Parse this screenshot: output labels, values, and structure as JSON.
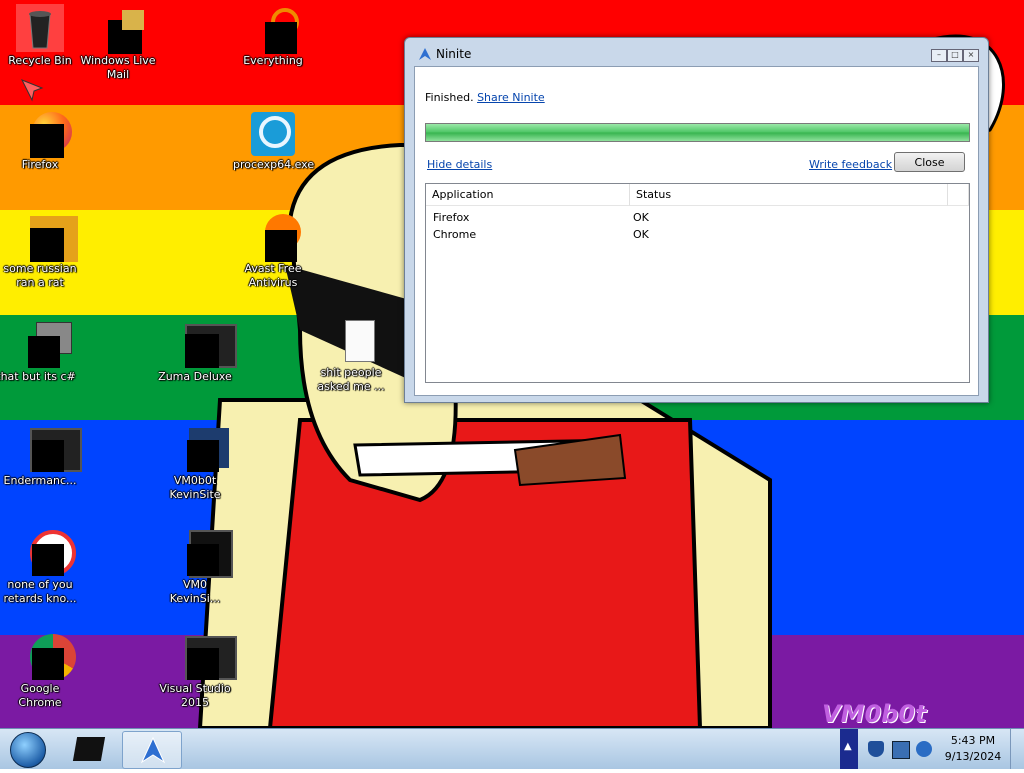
{
  "desktop": {
    "watermark": "VM0b0t",
    "colors": {
      "red": "#ff0000",
      "orange": "#ff9a00",
      "yellow": "#ffee00",
      "green": "#009a3a",
      "blue": "#0044ff",
      "purple": "#7b1aa3"
    },
    "icons": [
      {
        "label": "Recycle Bin",
        "icon": "recycle-bin-icon"
      },
      {
        "label": "Windows Live\nMail",
        "icon": "windows-live-mail-icon"
      },
      {
        "label": "Everything",
        "icon": "everything-search-icon"
      },
      {
        "label": "Firefox",
        "icon": "firefox-icon"
      },
      {
        "label": "procexp64.exe",
        "icon": "process-explorer-icon"
      },
      {
        "label": "some russian\nran a rat",
        "icon": "shortcut-icon"
      },
      {
        "label": "Avast Free\nAntivirus",
        "icon": "avast-icon"
      },
      {
        "label": "that but its c#",
        "icon": "folder-stack-icon"
      },
      {
        "label": "Zuma Deluxe",
        "icon": "zuma-deluxe-icon"
      },
      {
        "label": "shit people\nasked me ...",
        "icon": "text-file-icon"
      },
      {
        "label": "Endermanc...",
        "icon": "window-app-icon"
      },
      {
        "label": "VM0b0t\nKevinSite",
        "icon": "vm-icon"
      },
      {
        "label": "none of you\nretards kno...",
        "icon": "browser-shortcut-icon"
      },
      {
        "label": "VM0\nKevinSi...",
        "icon": "vm-icon"
      },
      {
        "label": "Google\nChrome",
        "icon": "chrome-icon"
      },
      {
        "label": "Visual Studio\n2015",
        "icon": "visual-studio-icon"
      }
    ]
  },
  "window": {
    "title": "Ninite",
    "status_text": "Finished.",
    "share_link": "Share Ninite",
    "progress": 1.0,
    "hide_details": "Hide details",
    "write_feedback": "Write feedback",
    "close_button": "Close",
    "columns": [
      "Application",
      "Status"
    ],
    "rows": [
      {
        "application": "Firefox",
        "status": "OK"
      },
      {
        "application": "Chrome",
        "status": "OK"
      }
    ]
  },
  "taskbar": {
    "time": "5:43 PM",
    "date": "9/13/2024",
    "items": [
      "desktop-app-icon",
      "ninite-icon"
    ]
  }
}
